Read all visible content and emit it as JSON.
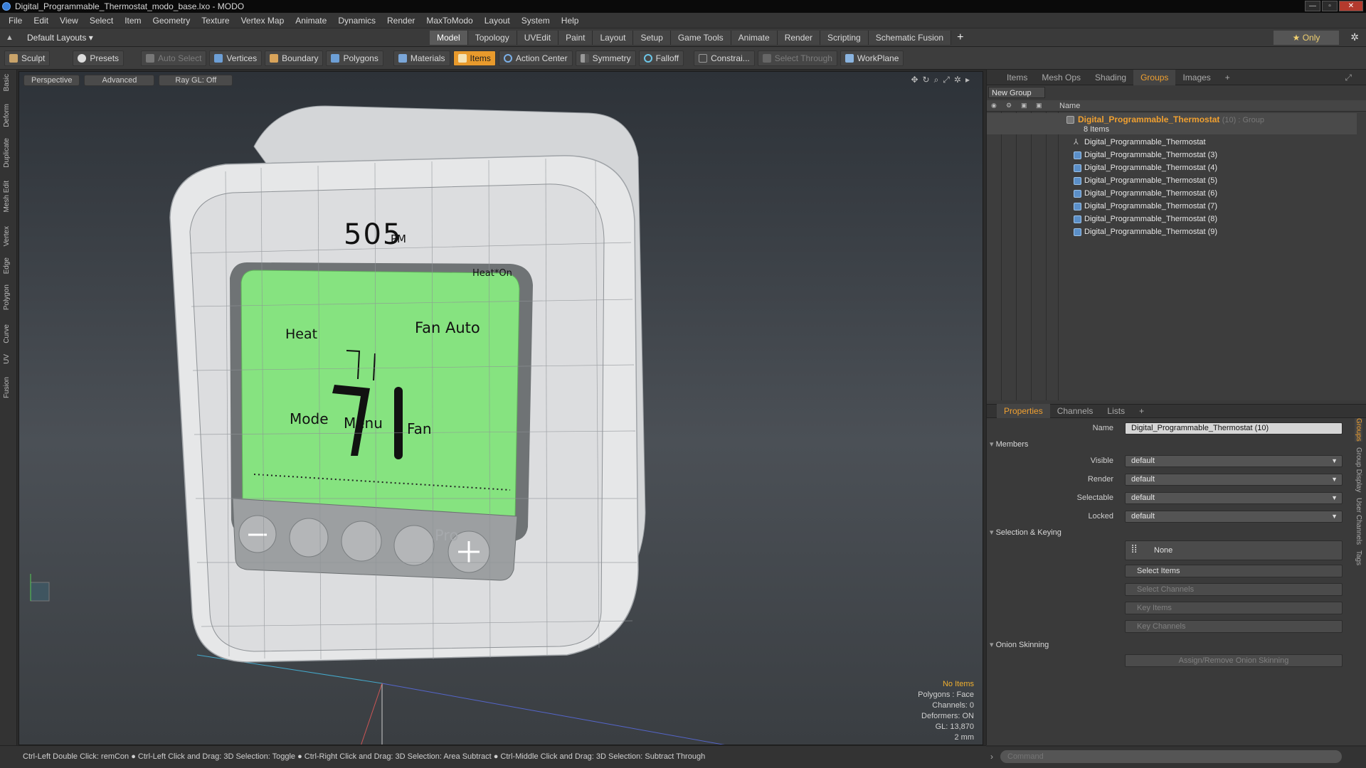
{
  "window": {
    "title": "Digital_Programmable_Thermostat_modo_base.lxo - MODO"
  },
  "menu": [
    "File",
    "Edit",
    "View",
    "Select",
    "Item",
    "Geometry",
    "Texture",
    "Vertex Map",
    "Animate",
    "Dynamics",
    "Render",
    "MaxToModo",
    "Layout",
    "System",
    "Help"
  ],
  "layoutbar": {
    "layouts_label": "Default Layouts ▾",
    "tabs": [
      "Model",
      "Topology",
      "UVEdit",
      "Paint",
      "Layout",
      "Setup",
      "Game Tools",
      "Animate",
      "Render",
      "Scripting",
      "Schematic Fusion"
    ],
    "active_tab": "Model",
    "only_label": "★  Only"
  },
  "toolbar": {
    "sculpt": "Sculpt",
    "presets": "Presets",
    "auto_select": "Auto Select",
    "vertices": "Vertices",
    "boundary": "Boundary",
    "polygons": "Polygons",
    "materials": "Materials",
    "items": "Items",
    "action_center": "Action Center",
    "symmetry": "Symmetry",
    "falloff": "Falloff",
    "constraints": "Constrai...",
    "select_through": "Select Through",
    "workplane": "WorkPlane"
  },
  "lefttabs": [
    "Basic",
    "Deform",
    "Duplicate",
    "Mesh Edit",
    "Vertex",
    "Edge",
    "Polygon",
    "Curve",
    "UV",
    "Fusion"
  ],
  "viewport": {
    "view_mode": "Perspective",
    "shading": "Advanced",
    "raygl": "Ray GL: Off",
    "lcd": {
      "time": "505",
      "pm": "PM",
      "heat_on": "Heat*On",
      "heat": "Heat",
      "fan_auto": "Fan Auto",
      "mode": "Mode",
      "menu": "Menu",
      "fan": "Fan",
      "brand": "Pro"
    },
    "info": {
      "no_items": "No Items",
      "polygons": "Polygons : Face",
      "channels": "Channels: 0",
      "deformers": "Deformers: ON",
      "gl": "GL: 13,870",
      "scale": "2 mm"
    }
  },
  "items_panel": {
    "tabs": [
      "Items",
      "Mesh Ops",
      "Shading",
      "Groups",
      "Images"
    ],
    "active_tab": "Groups",
    "new_group": "New Group",
    "name_header": "Name",
    "group": {
      "name": "Digital_Programmable_Thermostat",
      "suffix": "(10) : Group",
      "count": "8 Items"
    },
    "items": [
      "Digital_Programmable_Thermostat",
      "Digital_Programmable_Thermostat (3)",
      "Digital_Programmable_Thermostat (4)",
      "Digital_Programmable_Thermostat (5)",
      "Digital_Programmable_Thermostat (6)",
      "Digital_Programmable_Thermostat (7)",
      "Digital_Programmable_Thermostat (8)",
      "Digital_Programmable_Thermostat (9)"
    ]
  },
  "properties": {
    "tabs": [
      "Properties",
      "Channels",
      "Lists"
    ],
    "active_tab": "Properties",
    "name_label": "Name",
    "name_value": "Digital_Programmable_Thermostat (10)",
    "members": "Members",
    "visible_label": "Visible",
    "visible_value": "default",
    "render_label": "Render",
    "render_value": "default",
    "selectable_label": "Selectable",
    "selectable_value": "default",
    "locked_label": "Locked",
    "locked_value": "default",
    "selection_keying": "Selection & Keying",
    "none": "None",
    "select_items": "Select Items",
    "select_channels": "Select Channels",
    "key_items": "Key Items",
    "key_channels": "Key Channels",
    "onion_skinning": "Onion Skinning",
    "assign_onion": "Assign/Remove Onion Skinning",
    "side_tabs": [
      "Groups",
      "Group Display",
      "User Channels",
      "Tags"
    ]
  },
  "command": {
    "placeholder": "Command"
  },
  "status": {
    "text": "Ctrl-Left Double Click: remCon ● Ctrl-Left Click and Drag: 3D Selection: Toggle ● Ctrl-Right Click and Drag: 3D Selection: Area Subtract ● Ctrl-Middle Click and Drag: 3D Selection: Subtract Through"
  },
  "colors": {
    "accent": "#f0a030",
    "lcd_green": "#7fe07a",
    "tool_active": "#e89a2c"
  }
}
